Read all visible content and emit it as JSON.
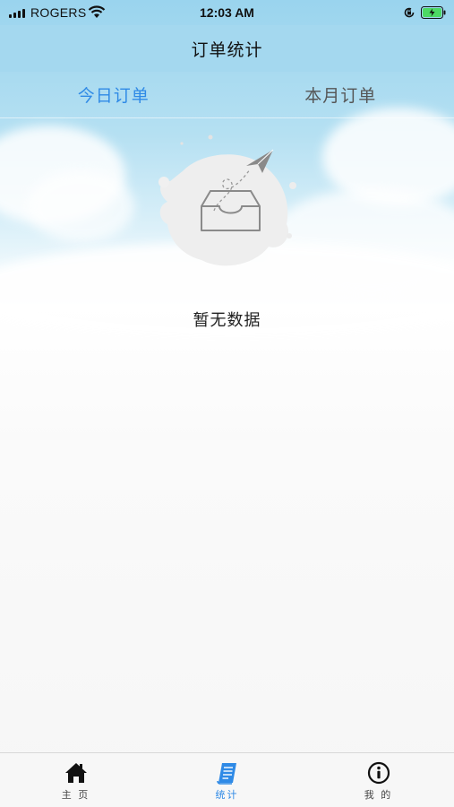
{
  "status_bar": {
    "carrier": "ROGERS",
    "time": "12:03 AM"
  },
  "nav": {
    "title": "订单统计"
  },
  "tabs": [
    {
      "label": "今日订单",
      "active": true
    },
    {
      "label": "本月订单",
      "active": false
    }
  ],
  "empty_state": {
    "message": "暂无数据",
    "icon": "empty-inbox-icon"
  },
  "tabbar": {
    "items": [
      {
        "label": "主 页",
        "icon": "home-icon",
        "active": false
      },
      {
        "label": "统计",
        "icon": "stats-icon",
        "active": true
      },
      {
        "label": "我 的",
        "icon": "info-icon",
        "active": false
      }
    ]
  },
  "colors": {
    "accent": "#2f8ae6",
    "nav_background": "#a4d8ef",
    "text_dark": "#222222"
  }
}
